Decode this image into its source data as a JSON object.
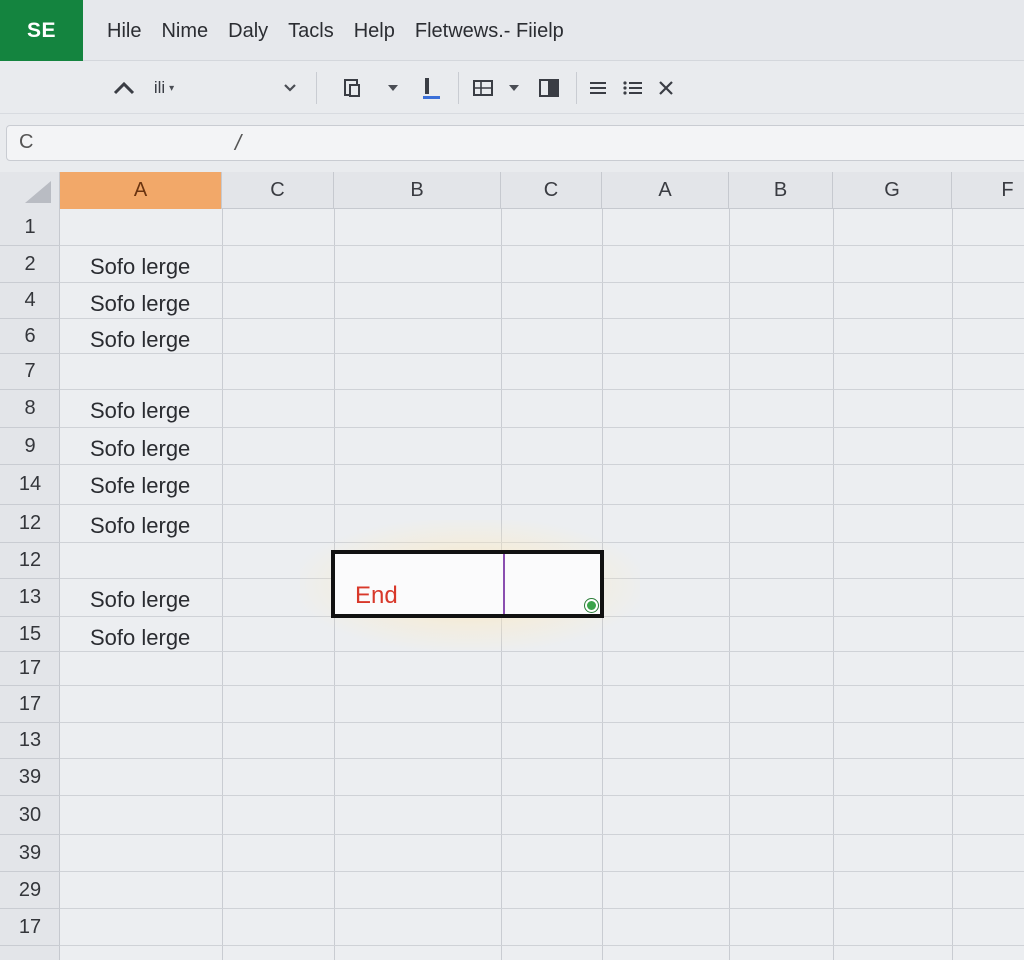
{
  "app": {
    "badge": "SE"
  },
  "menu": {
    "items": [
      "Hile",
      "Nime",
      "Daly",
      "Tacls",
      "Help",
      "Fletwews.- Fiielp"
    ]
  },
  "toolbar": {
    "font_label": "ili",
    "icons": [
      "caret-up-icon",
      "chevron-down-icon",
      "paste-icon",
      "chevron-down-icon",
      "text-color-icon",
      "table-icon",
      "chevron-down-icon",
      "freeze-pane-icon",
      "align-icon",
      "list-icon",
      "close-icon"
    ]
  },
  "formula_bar": {
    "name_box": "C",
    "fx": "/"
  },
  "columns": [
    "A",
    "C",
    "B",
    "C",
    "A",
    "B",
    "G",
    "F"
  ],
  "active_column": 0,
  "rows": [
    "1",
    "2",
    "4",
    "6",
    "7",
    "8",
    "9",
    "14",
    "12",
    "12",
    "13",
    "15",
    "17",
    "17",
    "13",
    "39",
    "30",
    "39",
    "29",
    "17"
  ],
  "cells": [
    {
      "row": 1,
      "text": "Sofo lerge"
    },
    {
      "row": 2,
      "text": "Sofo lerge"
    },
    {
      "row": 3,
      "text": "Sofo lerge"
    },
    {
      "row": 5,
      "text": "Sofo lerge"
    },
    {
      "row": 6,
      "text": "Sofo lerge"
    },
    {
      "row": 7,
      "text": "Sofe lerge"
    },
    {
      "row": 8,
      "text": "Sofo lerge"
    },
    {
      "row": 10,
      "text": "Sofo lerge"
    },
    {
      "row": 11,
      "text": "Sofo lerge"
    }
  ],
  "selection": {
    "text": "End"
  },
  "colors": {
    "accent": "#14843f",
    "active_header": "#f2a869",
    "selection_text": "#d8382a",
    "fill_handle": "#3aa44a"
  }
}
